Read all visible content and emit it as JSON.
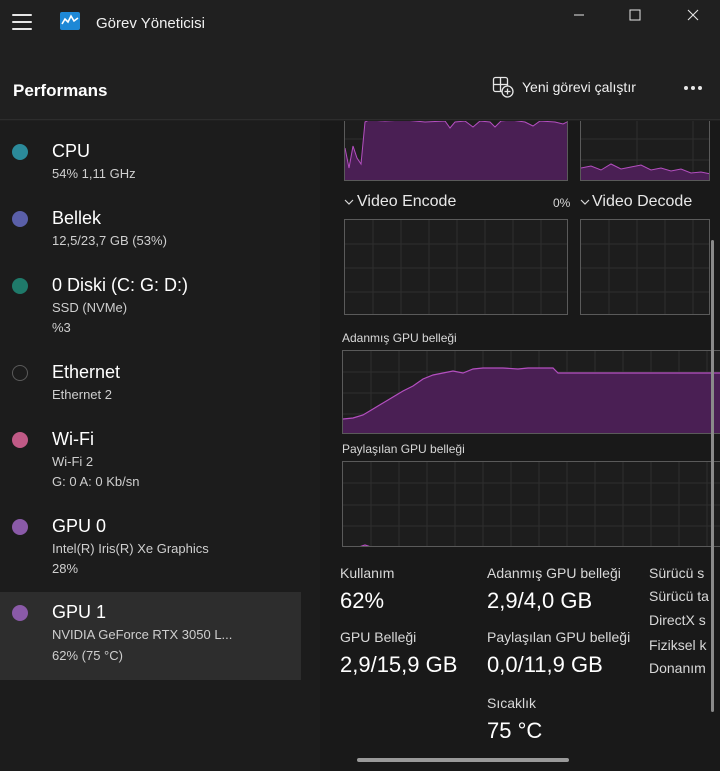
{
  "window": {
    "title": "Görev Yöneticisi"
  },
  "header": {
    "page_title": "Performans",
    "run_task_label": "Yeni görevi çalıştır"
  },
  "sidebar": {
    "items": [
      {
        "title": "CPU",
        "line1": "54%  1,11 GHz",
        "line2": "",
        "dot_color": "#2b8a9a"
      },
      {
        "title": "Bellek",
        "line1": "12,5/23,7 GB (53%)",
        "line2": "",
        "dot_color": "#5a5fa8"
      },
      {
        "title": "0 Diski (C: G: D:)",
        "line1": "SSD (NVMe)",
        "line2": "%3",
        "dot_color": "#1f7a6a"
      },
      {
        "title": "Ethernet",
        "line1": "Ethernet 2",
        "line2": "",
        "dot_color": "transparent"
      },
      {
        "title": "Wi-Fi",
        "line1": "Wi-Fi 2",
        "line2": "G: 0 A: 0 Kb/sn",
        "dot_color": "#c05a86"
      },
      {
        "title": "GPU 0",
        "line1": "Intel(R) Iris(R) Xe Graphics",
        "line2": "28%",
        "dot_color": "#8a5aa8"
      },
      {
        "title": "GPU 1",
        "line1": "NVIDIA GeForce RTX 3050 L...",
        "line2": "62%  (75 °C)",
        "dot_color": "#8a5aa8"
      }
    ]
  },
  "main": {
    "video_encode_label": "Video Encode",
    "video_encode_value": "0%",
    "video_decode_label": "Video Decode",
    "dedicated_mem_label": "Adanmış GPU belleği",
    "shared_mem_label": "Paylaşılan GPU belleği",
    "stats": {
      "usage_label": "Kullanım",
      "usage_value": "62%",
      "gpu_mem_label": "GPU Belleği",
      "gpu_mem_value": "2,9/15,9 GB",
      "dedicated_label": "Adanmış GPU belleği",
      "dedicated_value": "2,9/4,0 GB",
      "shared_label": "Paylaşılan GPU belleği",
      "shared_value": "0,0/11,9 GB",
      "temp_label": "Sıcaklık",
      "temp_value": "75 °C"
    },
    "details_clipped": [
      "Sürücü s",
      "Sürücü ta",
      "DirectX s",
      "Fiziksel k",
      "Donanım"
    ]
  },
  "colors": {
    "accent_purple": "#b44fc0",
    "graph_fill": "#4a1f54"
  }
}
